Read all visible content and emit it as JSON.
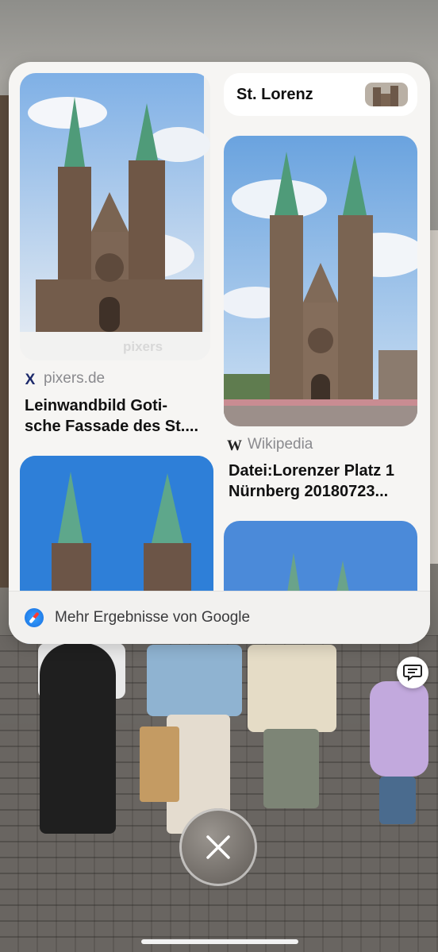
{
  "query": {
    "label": "St. Lorenz"
  },
  "results": [
    {
      "source": "pixers.de",
      "title_line1": "Leinwandbild Goti-",
      "title_line2": "sche Fassade des St....",
      "favicon": "X",
      "watermark": "pixers"
    },
    {
      "source": "Wikipedia",
      "title_line1": "Datei:Lorenzer Platz 1",
      "title_line2": "Nürnberg 20180723...",
      "favicon": "W"
    }
  ],
  "more_results": {
    "label": "Mehr Ergebnisse von Google"
  },
  "colors": {
    "sheet": "#f6f5f3",
    "sky": "#6aa3df",
    "stone": "#7a6452",
    "spire_green": "#4f9b79"
  },
  "icons": {
    "chat": "chat-bubble-icon",
    "close": "close-icon",
    "browser": "safari-icon"
  }
}
